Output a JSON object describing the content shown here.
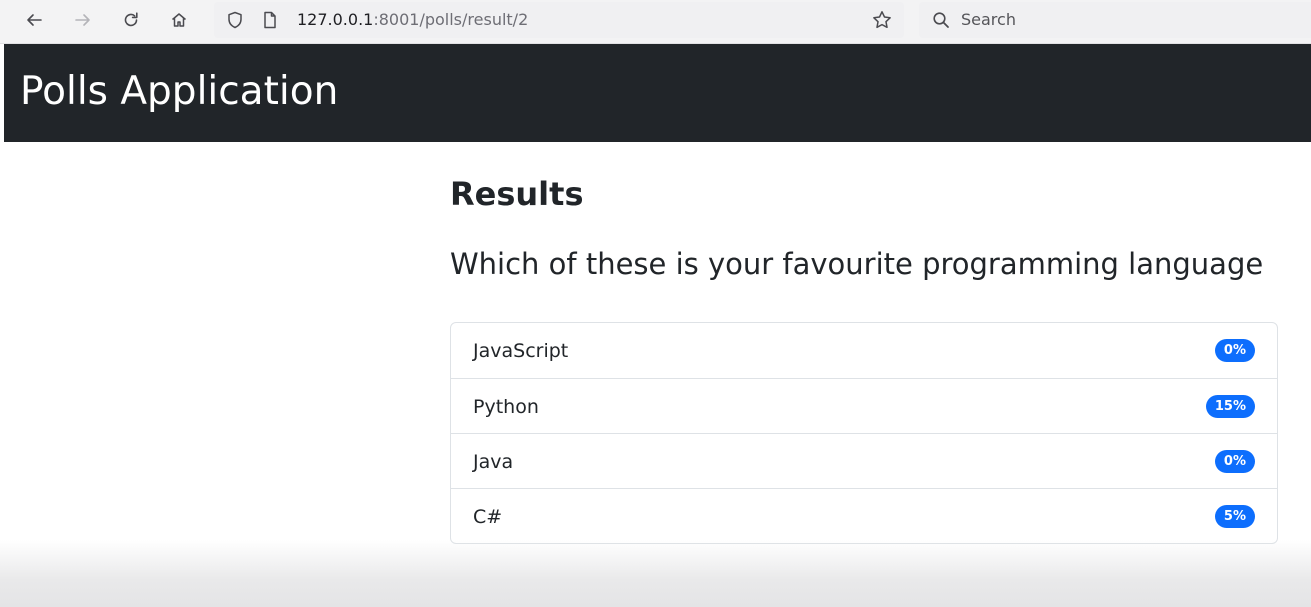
{
  "browser": {
    "url_host": "127.0.0.1",
    "url_rest": ":8001/polls/result/2",
    "search_placeholder": "Search"
  },
  "navbar": {
    "brand": "Polls Application"
  },
  "results": {
    "heading": "Results",
    "question": "Which of these is your favourite programming language",
    "items": [
      {
        "choice": "JavaScript",
        "percent": "0%"
      },
      {
        "choice": "Python",
        "percent": "15%"
      },
      {
        "choice": "Java",
        "percent": "0%"
      },
      {
        "choice": "C#",
        "percent": "5%"
      }
    ]
  },
  "icons": {
    "back": "back-arrow-icon",
    "forward": "forward-arrow-icon",
    "reload": "reload-icon",
    "home": "home-icon",
    "shield": "shield-icon",
    "page": "page-icon",
    "bookmark": "star-icon",
    "search": "search-icon"
  },
  "colors": {
    "navbar_bg": "#212529",
    "badge_bg": "#0d6efd",
    "text": "#212529"
  }
}
